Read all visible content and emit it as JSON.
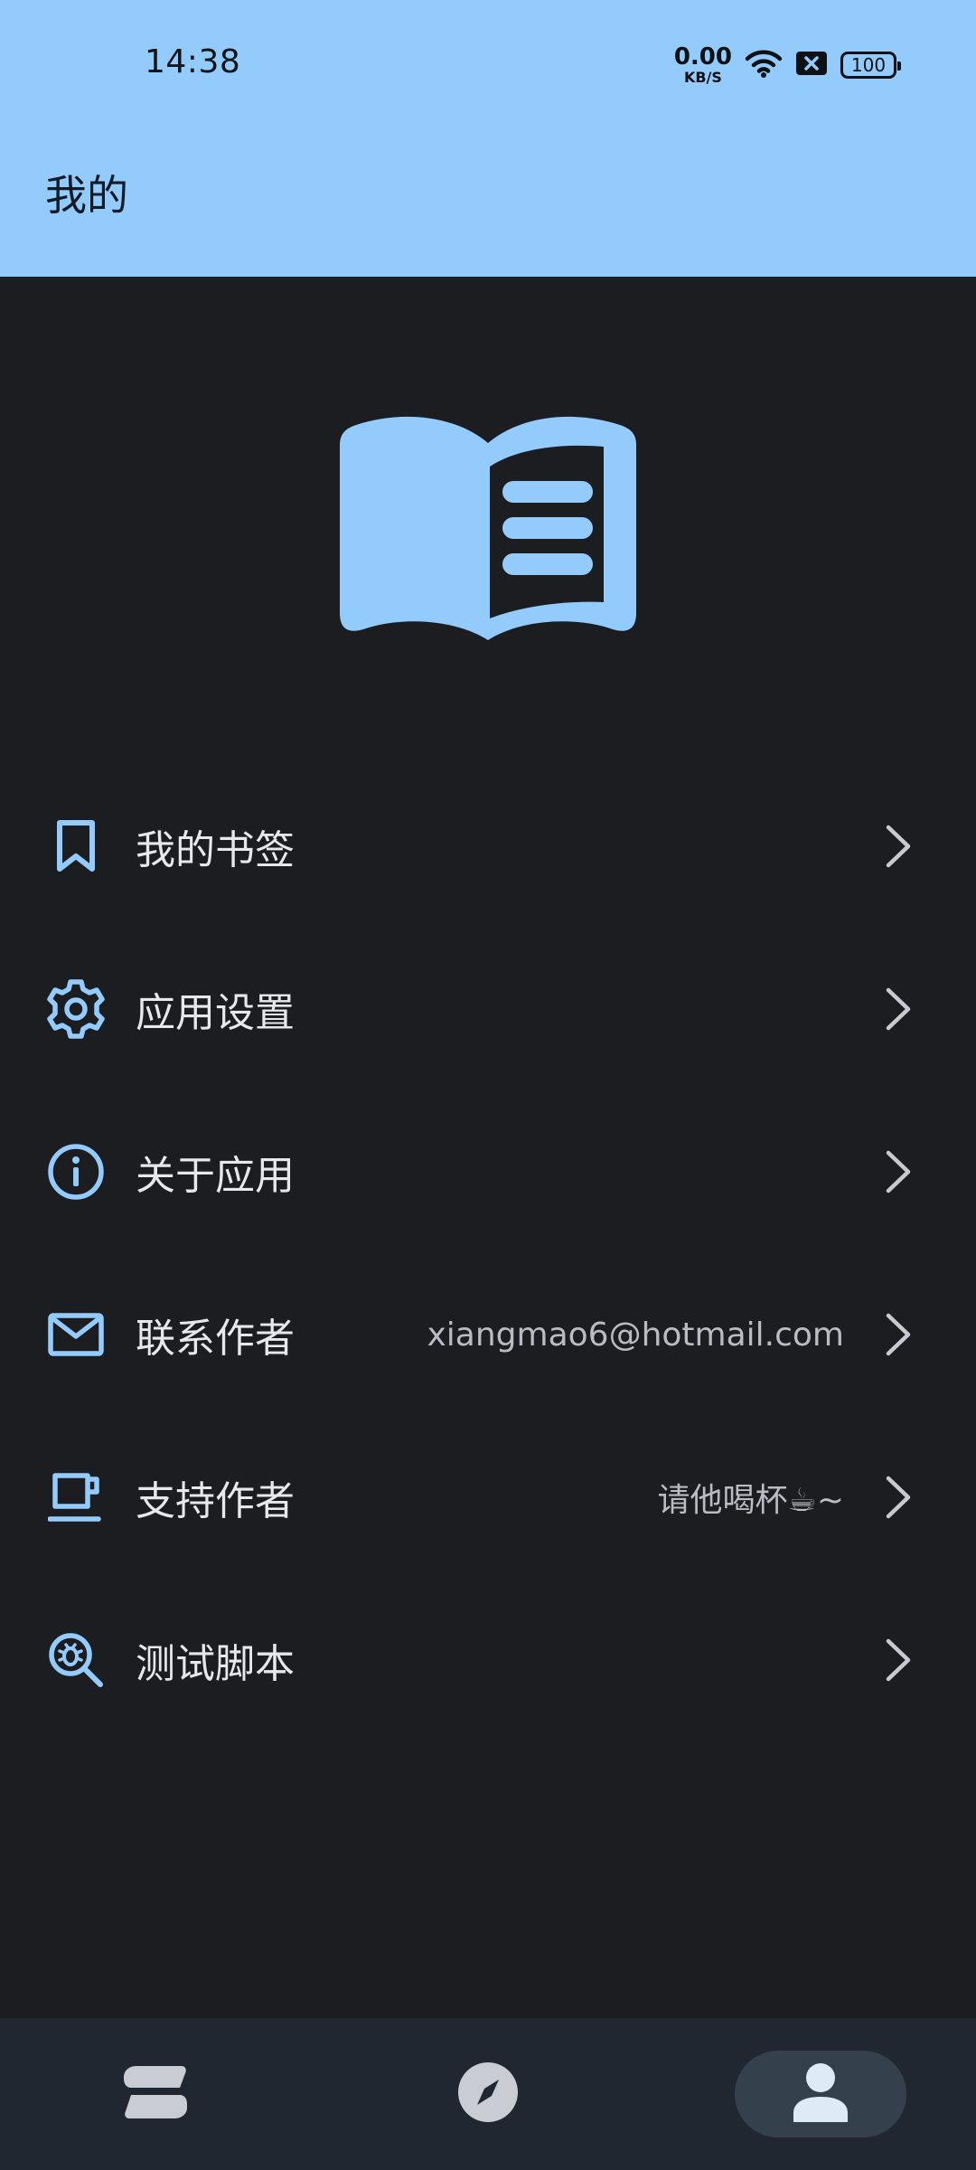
{
  "status_bar": {
    "time": "14:38",
    "net_speed_value": "0.00",
    "net_speed_unit": "KB/S",
    "battery": "100"
  },
  "header": {
    "title": "我的"
  },
  "menu": [
    {
      "icon": "bookmark-icon",
      "label": "我的书签",
      "value": ""
    },
    {
      "icon": "gear-icon",
      "label": "应用设置",
      "value": ""
    },
    {
      "icon": "info-icon",
      "label": "关于应用",
      "value": ""
    },
    {
      "icon": "mail-icon",
      "label": "联系作者",
      "value": "xiangmao6@hotmail.com"
    },
    {
      "icon": "coffee-cup-icon",
      "label": "支持作者",
      "value": "请他喝杯☕~"
    },
    {
      "icon": "bug-search-icon",
      "label": "测试脚本",
      "value": ""
    }
  ],
  "bottom_nav": {
    "items": [
      {
        "icon": "bookshelf-icon",
        "active": false
      },
      {
        "icon": "compass-icon",
        "active": false
      },
      {
        "icon": "person-icon",
        "active": true
      }
    ]
  },
  "colors": {
    "accent": "#94cbfd",
    "background": "#1c1d20",
    "bottom_nav": "#212731",
    "nav_active_pill": "#35404d"
  }
}
